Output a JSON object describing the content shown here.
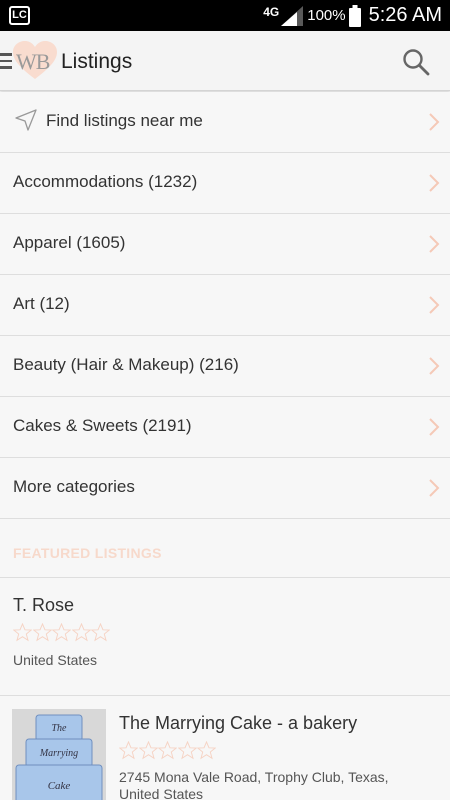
{
  "status_bar": {
    "carrier_badge": "LC",
    "network": "4G",
    "battery": "100%",
    "time": "5:26 AM"
  },
  "app_bar": {
    "logo_text": "WB",
    "title": "Listings"
  },
  "nearby": {
    "label": "Find listings near me"
  },
  "categories": [
    {
      "label": "Accommodations (1232)"
    },
    {
      "label": "Apparel (1605)"
    },
    {
      "label": "Art (12)"
    },
    {
      "label": "Beauty (Hair & Makeup) (216)"
    },
    {
      "label": "Cakes & Sweets (2191)"
    },
    {
      "label": "More categories"
    }
  ],
  "featured": {
    "header": "FEATURED LISTINGS",
    "items": [
      {
        "name": "T. Rose",
        "rating": 0,
        "location": "United States"
      },
      {
        "name": "The Marrying Cake - a bakery",
        "rating": 0,
        "address_line1": "2745 Mona Vale Road, Trophy Club, Texas,",
        "address_line2": "United States",
        "thumb_words": [
          "The",
          "Marrying",
          "Cake"
        ]
      }
    ]
  },
  "colors": {
    "accent_peach": "#f7d9cb",
    "chevron": "#f5c9b7",
    "star_outline": "#f6d3c4"
  }
}
